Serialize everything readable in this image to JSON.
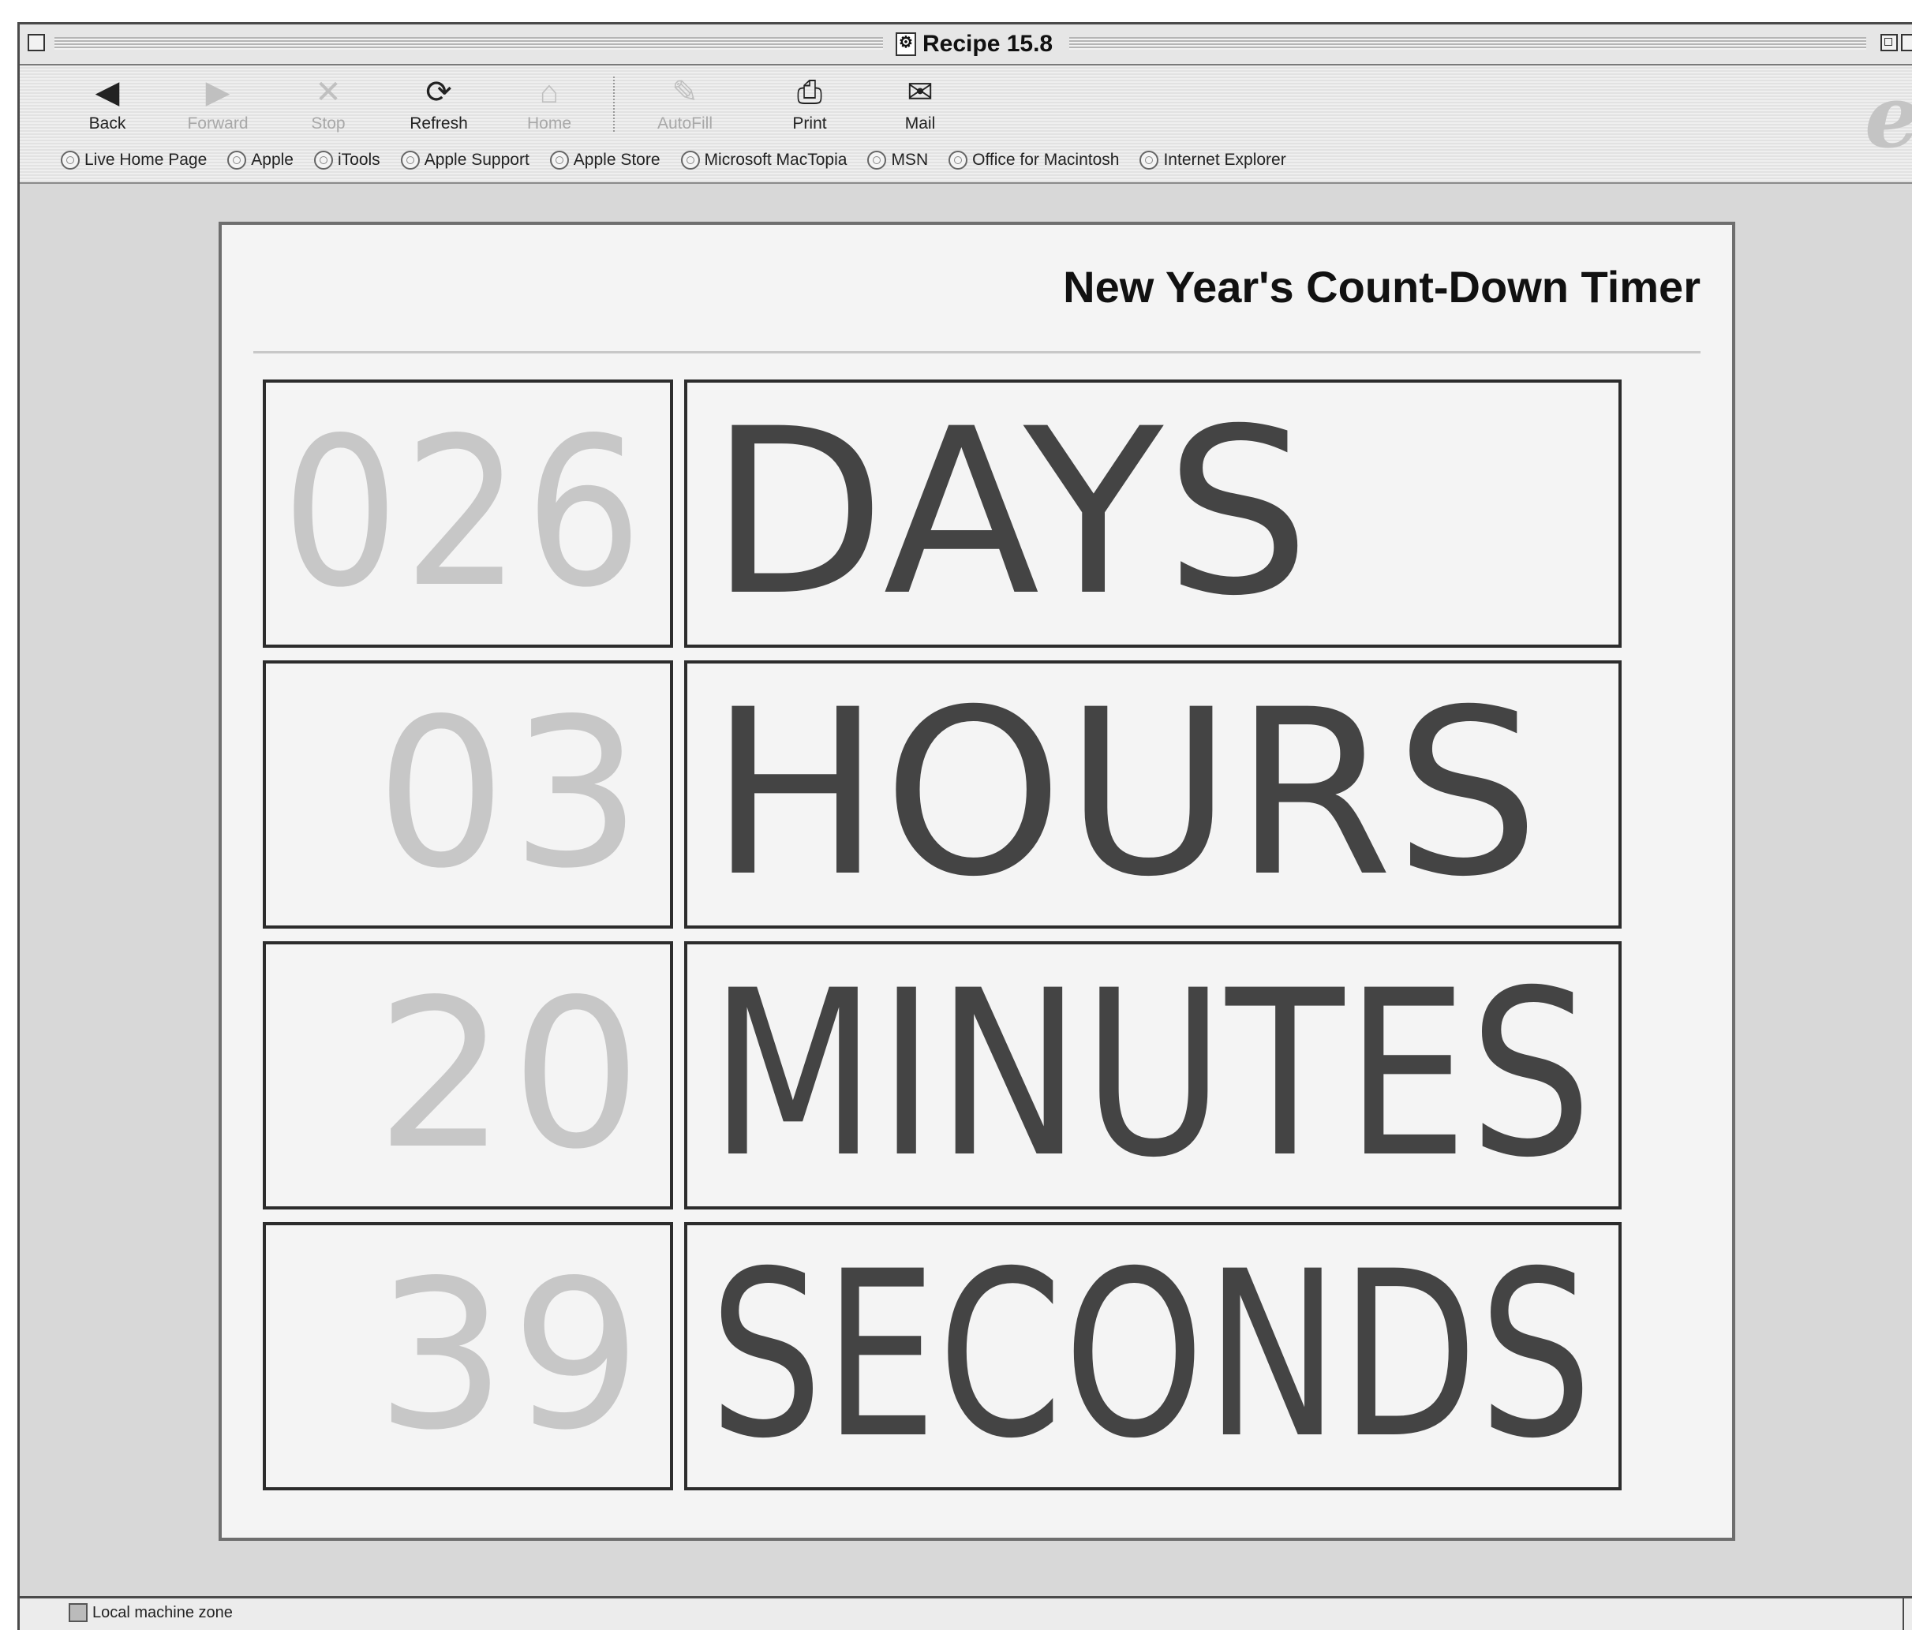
{
  "window": {
    "title": "Recipe 15.8"
  },
  "toolbar": {
    "buttons": [
      {
        "label": "Back",
        "icon": "back-arrow-icon",
        "enabled": true
      },
      {
        "label": "Forward",
        "icon": "forward-arrow-icon",
        "enabled": false
      },
      {
        "label": "Stop",
        "icon": "stop-icon",
        "enabled": false
      },
      {
        "label": "Refresh",
        "icon": "refresh-icon",
        "enabled": true
      },
      {
        "label": "Home",
        "icon": "home-icon",
        "enabled": false
      },
      {
        "label": "AutoFill",
        "icon": "autofill-icon",
        "enabled": false
      },
      {
        "label": "Print",
        "icon": "print-icon",
        "enabled": true
      },
      {
        "label": "Mail",
        "icon": "mail-icon",
        "enabled": true
      }
    ]
  },
  "favorites": [
    "Live Home Page",
    "Apple",
    "iTools",
    "Apple Support",
    "Apple Store",
    "Microsoft MacTopia",
    "MSN",
    "Office for Macintosh",
    "Internet Explorer"
  ],
  "page": {
    "heading": "New Year's Count-Down Timer",
    "rows": [
      {
        "number": "026",
        "unit": "DAYS"
      },
      {
        "number": "03",
        "unit": "HOURS"
      },
      {
        "number": "20",
        "unit": "MINUTES"
      },
      {
        "number": "39",
        "unit": "SECONDS"
      }
    ]
  },
  "status": {
    "zone": "Local machine zone"
  },
  "colors": {
    "number_text": "#c7c7c7",
    "unit_text": "#444444",
    "panel_background": "#f4f4f4",
    "window_background": "#d8d8d8"
  }
}
